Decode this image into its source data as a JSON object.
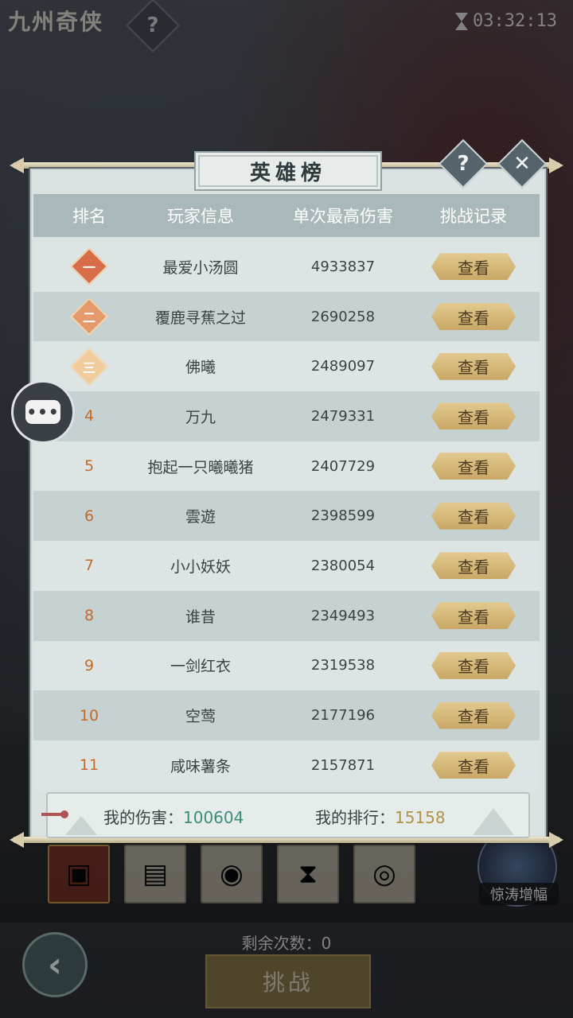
{
  "top": {
    "game_logo": "九州奇侠",
    "help_glyph": "?",
    "timer": "03:32:13"
  },
  "panel": {
    "title": "英雄榜",
    "help_glyph": "?",
    "close_glyph": "✕",
    "headers": [
      "排名",
      "玩家信息",
      "单次最高伤害",
      "挑战记录"
    ],
    "rows": [
      {
        "rank": "一",
        "badge": true,
        "name": "最爱小汤圆",
        "damage": "4933837",
        "action": "查看"
      },
      {
        "rank": "二",
        "badge": true,
        "name": "覆鹿寻蕉之过",
        "damage": "2690258",
        "action": "查看"
      },
      {
        "rank": "三",
        "badge": true,
        "name": "佛曦",
        "damage": "2489097",
        "action": "查看"
      },
      {
        "rank": "4",
        "badge": false,
        "name": "万九",
        "damage": "2479331",
        "action": "查看"
      },
      {
        "rank": "5",
        "badge": false,
        "name": "抱起一只曦曦猪",
        "damage": "2407729",
        "action": "查看"
      },
      {
        "rank": "6",
        "badge": false,
        "name": "雲遊",
        "damage": "2398599",
        "action": "查看"
      },
      {
        "rank": "7",
        "badge": false,
        "name": "小小妖妖",
        "damage": "2380054",
        "action": "查看"
      },
      {
        "rank": "8",
        "badge": false,
        "name": "谁昔",
        "damage": "2349493",
        "action": "查看"
      },
      {
        "rank": "9",
        "badge": false,
        "name": "一剑红衣",
        "damage": "2319538",
        "action": "查看"
      },
      {
        "rank": "10",
        "badge": false,
        "name": "空莺",
        "damage": "2177196",
        "action": "查看"
      },
      {
        "rank": "11",
        "badge": false,
        "name": "咸味薯条",
        "damage": "2157871",
        "action": "查看"
      }
    ],
    "footer": {
      "my_damage_label": "我的伤害：",
      "my_damage": "100604",
      "my_rank_label": "我的排行：",
      "my_rank": "15158"
    }
  },
  "bottom": {
    "buff_label": "惊涛增幅",
    "remaining": "剩余次数：0",
    "challenge_label": "挑战",
    "back_glyph": "‹"
  },
  "colors": {
    "accent_orange": "#c46a2a",
    "damage_green": "#3a8d7c",
    "rank_gold": "#b09447"
  }
}
